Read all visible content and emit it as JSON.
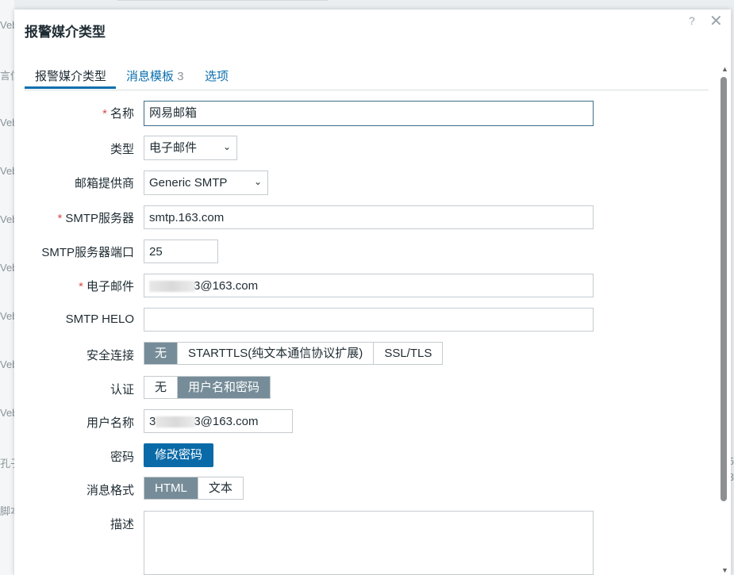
{
  "background": {
    "left_fragments": [
      "Veb",
      "言信",
      "Veb",
      "Veb",
      "Veb",
      "Veb",
      "Veb",
      "Veb",
      "Veb",
      "孔子",
      "脚本"
    ],
    "right_fragments": [
      "5",
      "3"
    ]
  },
  "dialog": {
    "title": "报警媒介类型",
    "help": "?",
    "close": "✕"
  },
  "tabs": [
    {
      "label": "报警媒介类型"
    },
    {
      "label": "消息模板",
      "count": "3"
    },
    {
      "label": "选项"
    }
  ],
  "form": {
    "name": {
      "label": "名称",
      "value": "网易邮箱"
    },
    "type": {
      "label": "类型",
      "value": "电子邮件"
    },
    "provider": {
      "label": "邮箱提供商",
      "value": "Generic SMTP"
    },
    "smtp_server": {
      "label": "SMTP服务器",
      "value": "smtp.163.com"
    },
    "smtp_port": {
      "label": "SMTP服务器端口",
      "value": "25"
    },
    "email": {
      "label": "电子邮件",
      "value": "3@163.com"
    },
    "smtp_helo": {
      "label": "SMTP HELO",
      "value": ""
    },
    "security": {
      "label": "安全连接",
      "options": [
        "无",
        "STARTTLS(纯文本通信协议扩展)",
        "SSL/TLS"
      ],
      "selected": 0
    },
    "auth": {
      "label": "认证",
      "options": [
        "无",
        "用户名和密码"
      ],
      "selected": 1
    },
    "username": {
      "label": "用户名称",
      "prefix": "3",
      "value": "3@163.com"
    },
    "password": {
      "label": "密码",
      "button": "修改密码"
    },
    "msg_format": {
      "label": "消息格式",
      "options": [
        "HTML",
        "文本"
      ],
      "selected": 0
    },
    "description": {
      "label": "描述",
      "value": ""
    },
    "required_mark": "*"
  },
  "colors": {
    "accent": "#0a6aa8",
    "segment_selected": "#768d99",
    "required": "#d64e4e"
  }
}
